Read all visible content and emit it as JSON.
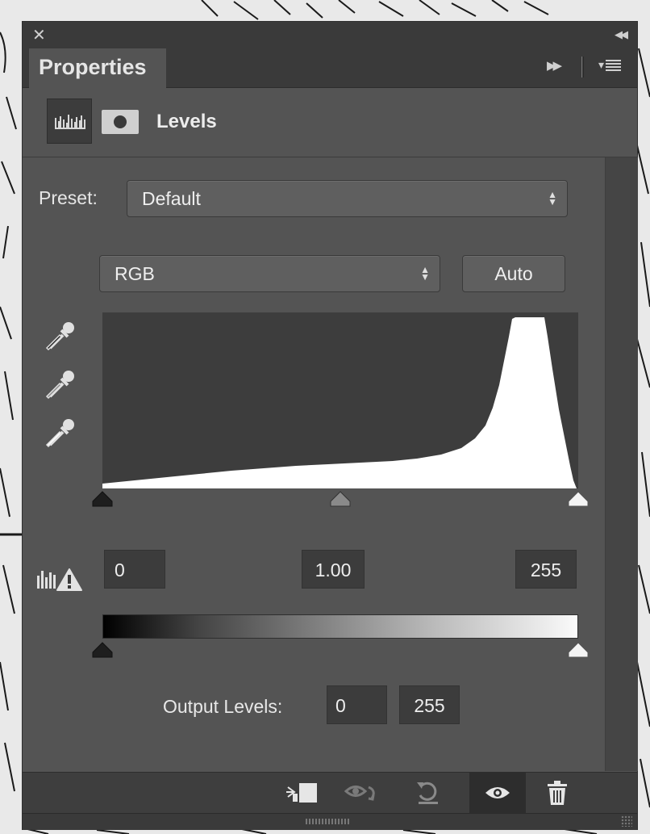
{
  "panel": {
    "tab_label": "Properties",
    "adjustment_title": "Levels"
  },
  "preset": {
    "label": "Preset:",
    "value": "Default"
  },
  "channel": {
    "value": "RGB",
    "auto_label": "Auto"
  },
  "input_levels": {
    "black": "0",
    "gamma": "1.00",
    "white": "255"
  },
  "output_levels": {
    "label": "Output Levels:",
    "black": "0",
    "white": "255"
  },
  "icons": {
    "close": "close-icon",
    "collapse": "double-chevron-left-icon",
    "tab_forward": "double-play-icon",
    "panel_menu": "panel-menu-icon",
    "levels": "histogram-icon",
    "mask": "mask-icon",
    "eyedroppers": [
      "black-point-eyedropper-icon",
      "gray-point-eyedropper-icon",
      "white-point-eyedropper-icon"
    ],
    "clip_warning": "clipping-warning-icon",
    "footer": [
      "clip-to-layer-icon",
      "view-previous-state-icon",
      "reset-icon",
      "visibility-eye-icon",
      "trash-icon"
    ]
  },
  "colors": {
    "panel_bg": "#545454",
    "chrome_bg": "#3a3a3a",
    "histogram_bg": "#3d3d3d",
    "histogram_fill": "#ffffff"
  }
}
